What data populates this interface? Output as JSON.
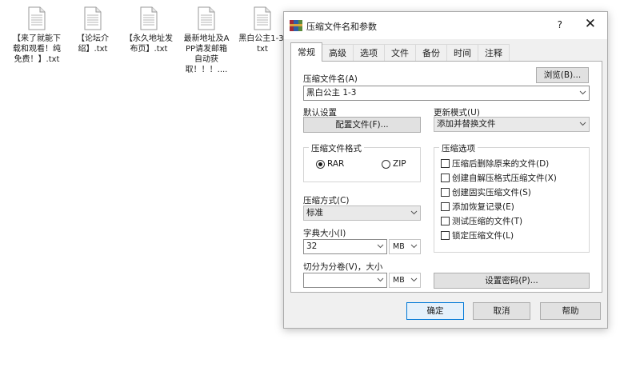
{
  "desktop": {
    "files": [
      {
        "label": "【来了就能下载和观看！纯免费！】.txt"
      },
      {
        "label": "【论坛介绍】.txt"
      },
      {
        "label": "【永久地址发布页】.txt"
      },
      {
        "label": "最新地址及APP请发邮箱自动获取！！！...."
      },
      {
        "label": "黑白公主1-3.txt"
      }
    ]
  },
  "dialog": {
    "title": "压缩文件名和参数",
    "help": "?",
    "close": "✕",
    "tabs": [
      "常规",
      "高级",
      "选项",
      "文件",
      "备份",
      "时间",
      "注释"
    ],
    "archive_name_label": "压缩文件名(A)",
    "browse_label": "浏览(B)...",
    "archive_name_value": "黑白公主 1-3",
    "defaults_label": "默认设置",
    "profiles_button": "配置文件(F)...",
    "update_mode_label": "更新模式(U)",
    "update_mode_value": "添加并替换文件",
    "format_group_title": "压缩文件格式",
    "format_rar": "RAR",
    "format_zip": "ZIP",
    "method_label": "压缩方式(C)",
    "method_value": "标准",
    "dict_label": "字典大小(I)",
    "dict_value": "32",
    "dict_unit": "MB",
    "split_label": "切分为分卷(V)，大小",
    "split_value": "",
    "split_unit": "MB",
    "options_group_title": "压缩选项",
    "options": [
      "压缩后删除原来的文件(D)",
      "创建自解压格式压缩文件(X)",
      "创建固实压缩文件(S)",
      "添加恢复记录(E)",
      "测试压缩的文件(T)",
      "锁定压缩文件(L)"
    ],
    "password_button": "设置密码(P)...",
    "ok_button": "确定",
    "cancel_button": "取消",
    "help_button": "帮助"
  }
}
